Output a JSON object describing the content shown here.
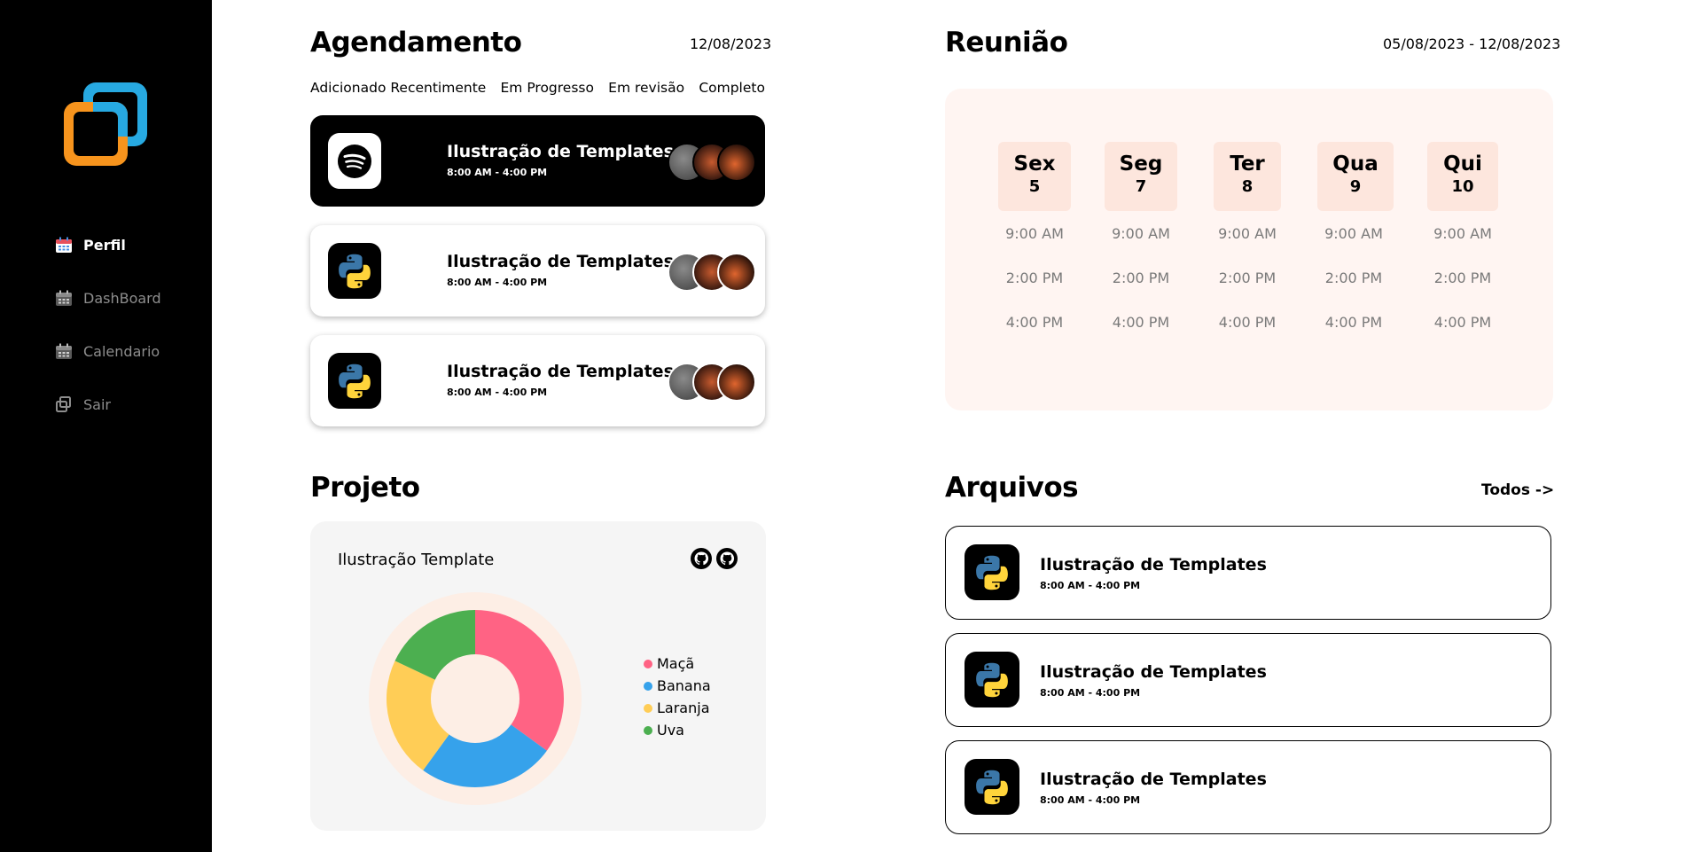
{
  "sidebar": {
    "items": [
      {
        "label": "Perfil",
        "icon": "calendar-icon",
        "active": true
      },
      {
        "label": "DashBoard",
        "icon": "calendar-icon",
        "active": false
      },
      {
        "label": "Calendario",
        "icon": "calendar-icon",
        "active": false
      },
      {
        "label": "Sair",
        "icon": "window-icon",
        "active": false
      }
    ]
  },
  "agendamento": {
    "title": "Agendamento",
    "date": "12/08/2023",
    "tabs": [
      "Adicionado Recentimente",
      "Em Progresso",
      "Em revisão",
      "Completo"
    ],
    "tasks": [
      {
        "title": "Ilustração de Templates",
        "time": "8:00 AM - 4:00 PM",
        "icon": "spotify-icon"
      },
      {
        "title": "Ilustração de Templates",
        "time": "8:00 AM - 4:00 PM",
        "icon": "python-icon"
      },
      {
        "title": "Ilustração de Templates",
        "time": "8:00 AM - 4:00 PM",
        "icon": "python-icon"
      }
    ]
  },
  "reuniao": {
    "title": "Reunião",
    "date_range": "05/08/2023 - 12/08/2023",
    "days": [
      {
        "name": "Sex",
        "num": "5",
        "slots": [
          "9:00 AM",
          "2:00 PM",
          "4:00 PM"
        ]
      },
      {
        "name": "Seg",
        "num": "7",
        "slots": [
          "9:00 AM",
          "2:00 PM",
          "4:00 PM"
        ]
      },
      {
        "name": "Ter",
        "num": "8",
        "slots": [
          "9:00 AM",
          "2:00 PM",
          "4:00 PM"
        ]
      },
      {
        "name": "Qua",
        "num": "9",
        "slots": [
          "9:00 AM",
          "2:00 PM",
          "4:00 PM"
        ]
      },
      {
        "name": "Qui",
        "num": "10",
        "slots": [
          "9:00 AM",
          "2:00 PM",
          "4:00 PM"
        ]
      }
    ]
  },
  "projeto": {
    "title": "Projeto",
    "card_title": "Ilustração Template"
  },
  "chart_data": {
    "type": "pie",
    "categories": [
      "Maçã",
      "Banana",
      "Laranja",
      "Uva"
    ],
    "values": [
      35,
      25,
      22,
      18
    ],
    "colors": [
      "#ff6384",
      "#36a2eb",
      "#ffcd56",
      "#4caf50"
    ],
    "legend_position": "right"
  },
  "arquivos": {
    "title": "Arquivos",
    "all_link": "Todos ->",
    "files": [
      {
        "title": "Ilustração de Templates",
        "time": "8:00 AM - 4:00 PM",
        "icon": "python-icon"
      },
      {
        "title": "Ilustração de Templates",
        "time": "8:00 AM - 4:00 PM",
        "icon": "python-icon"
      },
      {
        "title": "Ilustração de Templates",
        "time": "8:00 AM - 4:00 PM",
        "icon": "python-icon"
      }
    ]
  }
}
